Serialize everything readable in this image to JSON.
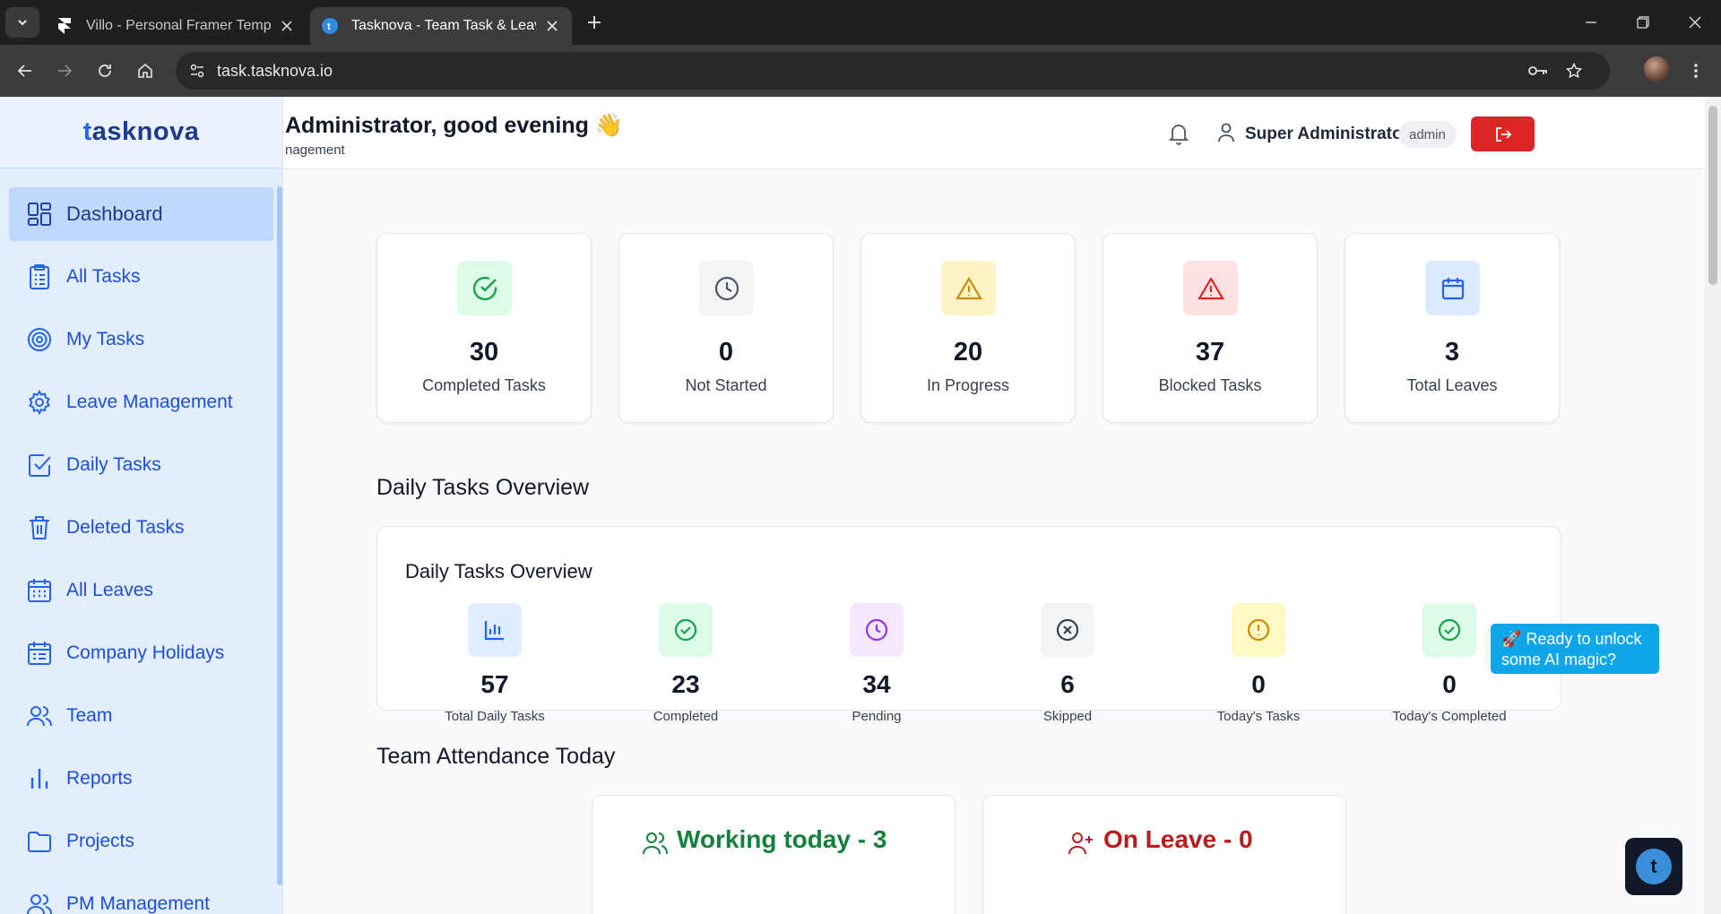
{
  "browser": {
    "tabs": [
      {
        "title": "Villo - Personal Framer Template",
        "active": false
      },
      {
        "title": "Tasknova - Team Task & Leave Management",
        "active": true
      }
    ],
    "url": "task.tasknova.io"
  },
  "sidebar": {
    "logo": {
      "accent": "t",
      "rest": "asknova"
    },
    "items": [
      {
        "label": "Dashboard",
        "icon": "dashboard-icon",
        "active": true
      },
      {
        "label": "All Tasks",
        "icon": "clipboard-icon"
      },
      {
        "label": "My Tasks",
        "icon": "target-icon"
      },
      {
        "label": "Leave Management",
        "icon": "gear-icon"
      },
      {
        "label": "Daily Tasks",
        "icon": "checkbox-icon"
      },
      {
        "label": "Deleted Tasks",
        "icon": "trash-icon"
      },
      {
        "label": "All Leaves",
        "icon": "calendar-icon"
      },
      {
        "label": "Company Holidays",
        "icon": "calendar-list-icon"
      },
      {
        "label": "Team",
        "icon": "users-icon"
      },
      {
        "label": "Reports",
        "icon": "bar-chart-icon"
      },
      {
        "label": "Projects",
        "icon": "folder-icon"
      },
      {
        "label": "PM Management",
        "icon": "users-gear-icon"
      }
    ]
  },
  "header": {
    "greeting": "Administrator, good evening 👋",
    "subtitle": "nagement",
    "user_name": "Super Administrator",
    "role": "admin"
  },
  "stats": [
    {
      "value": "30",
      "label": "Completed Tasks",
      "icon": "check-circle-icon",
      "bg": "#dcfce7",
      "color": "#16a34a"
    },
    {
      "value": "0",
      "label": "Not Started",
      "icon": "clock-icon",
      "bg": "#f3f4f6",
      "color": "#4b5563"
    },
    {
      "value": "20",
      "label": "In Progress",
      "icon": "warning-icon",
      "bg": "#fef3c7",
      "color": "#ca8a04"
    },
    {
      "value": "37",
      "label": "Blocked Tasks",
      "icon": "warning-icon",
      "bg": "#fee2e2",
      "color": "#dc2626"
    },
    {
      "value": "3",
      "label": "Total Leaves",
      "icon": "calendar-icon",
      "bg": "#dbeafe",
      "color": "#2563eb"
    }
  ],
  "daily_section_title": "Daily Tasks Overview",
  "daily": {
    "title": "Daily Tasks Overview",
    "items": [
      {
        "value": "57",
        "label": "Total Daily Tasks",
        "icon": "bar-chart-icon",
        "bg": "#e0ecff",
        "color": "#2563eb"
      },
      {
        "value": "23",
        "label": "Completed",
        "icon": "check-circle-icon",
        "bg": "#dcfce7",
        "color": "#16a34a"
      },
      {
        "value": "34",
        "label": "Pending",
        "icon": "clock-icon",
        "bg": "#f3e8ff",
        "color": "#9333ea"
      },
      {
        "value": "6",
        "label": "Skipped",
        "icon": "x-circle-icon",
        "bg": "#f3f4f6",
        "color": "#374151"
      },
      {
        "value": "0",
        "label": "Today's Tasks",
        "icon": "alert-circle-icon",
        "bg": "#fef9c3",
        "color": "#ca8a04"
      },
      {
        "value": "0",
        "label": "Today's Completed",
        "icon": "check-circle-icon",
        "bg": "#dcfce7",
        "color": "#16a34a"
      }
    ]
  },
  "attendance_title": "Team Attendance Today",
  "attendance": {
    "working": {
      "text": "Working today - 3",
      "color": "#15803d"
    },
    "on_leave": {
      "text": "On Leave - 0",
      "color": "#b91c1c"
    }
  },
  "ai_banner": "🚀 Ready to unlock some AI magic?",
  "chat_button_glyph": "t"
}
